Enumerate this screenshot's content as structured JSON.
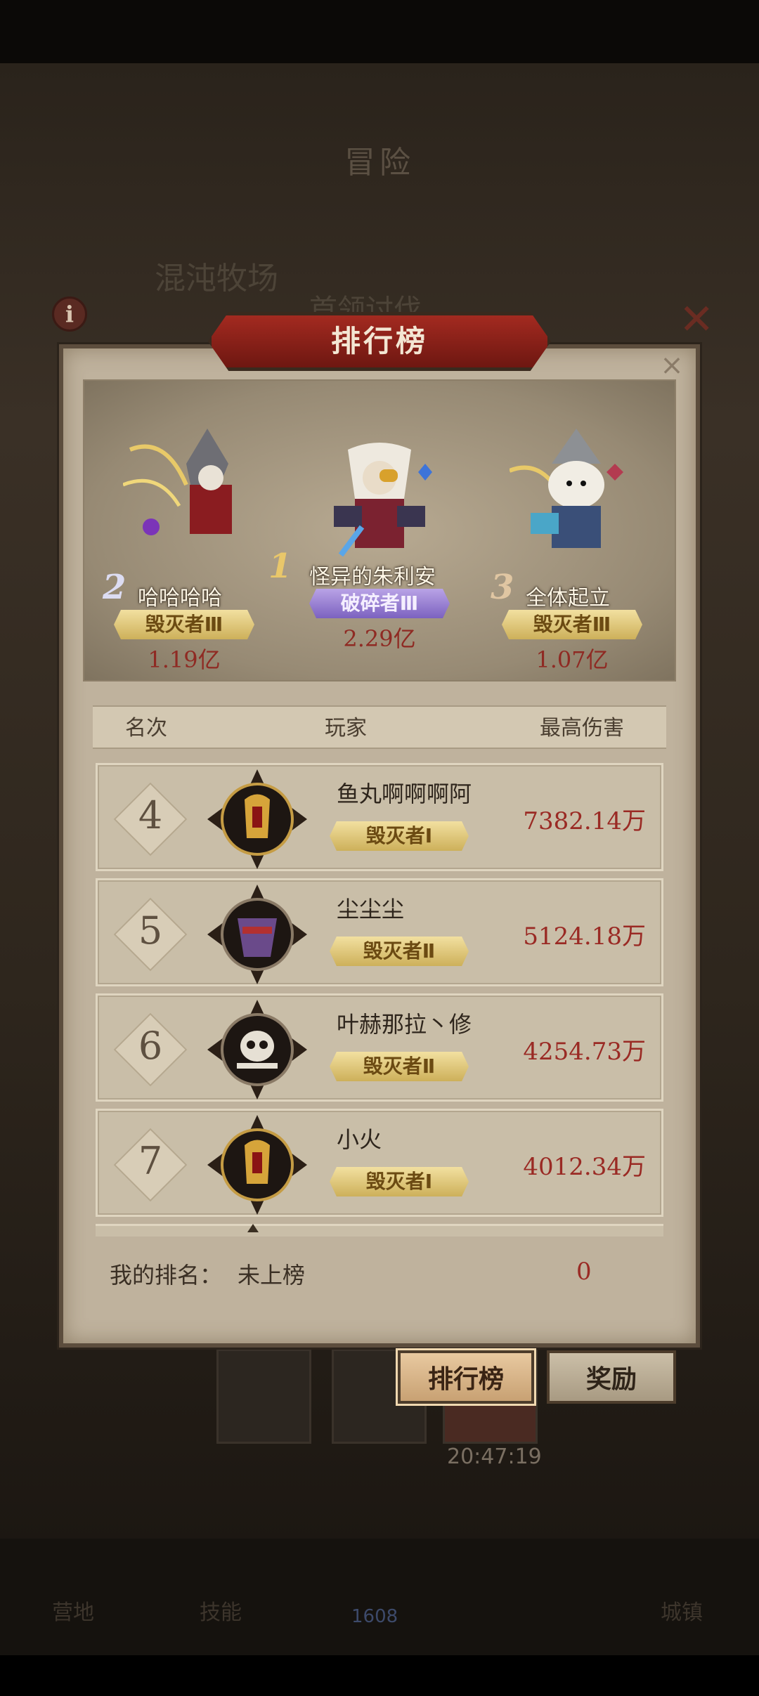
{
  "background": {
    "screen_title": "冒险",
    "sub_title": "混沌牧场",
    "sub_title2": "首领讨伐",
    "timer": "20:47:19",
    "nav_items": [
      "营地",
      "技能",
      "",
      "",
      "城镇"
    ],
    "nav_number": "1608"
  },
  "panel": {
    "title": "排行榜",
    "close_icon": "close-icon"
  },
  "podium": [
    {
      "rank": "2",
      "name": "哈哈哈哈",
      "title": "毁灭者Ⅲ",
      "score": "1.19亿",
      "badge_color": "gold"
    },
    {
      "rank": "1",
      "name": "怪异的朱利安",
      "title": "破碎者Ⅲ",
      "score": "2.29亿",
      "badge_color": "purple"
    },
    {
      "rank": "3",
      "name": "全体起立",
      "title": "毁灭者Ⅲ",
      "score": "1.07亿",
      "badge_color": "gold"
    }
  ],
  "table": {
    "headers": {
      "rank": "名次",
      "player": "玩家",
      "damage": "最高伤害"
    },
    "rows": [
      {
        "rank": "4",
        "name": "鱼丸啊啊啊阿",
        "title": "毁灭者Ⅰ",
        "damage": "7382.14万",
        "avatar": "golden-mask-avatar"
      },
      {
        "rank": "5",
        "name": "尘尘尘",
        "title": "毁灭者Ⅱ",
        "damage": "5124.18万",
        "avatar": "purple-demon-avatar"
      },
      {
        "rank": "6",
        "name": "叶赫那拉丶修",
        "title": "毁灭者Ⅱ",
        "damage": "4254.73万",
        "avatar": "skull-avatar"
      },
      {
        "rank": "7",
        "name": "小火",
        "title": "毁灭者Ⅰ",
        "damage": "4012.34万",
        "avatar": "golden-mask-avatar"
      }
    ]
  },
  "footer": {
    "my_rank_label": "我的排名：",
    "my_rank_value": "未上榜",
    "my_score": "0"
  },
  "buttons": {
    "rank": "排行榜",
    "reward": "奖励"
  },
  "colors": {
    "damage_red": "#9a2a24",
    "banner_red": "#a32a20",
    "badge_gold": "#e6cf82",
    "badge_purple": "#9b82d6"
  }
}
